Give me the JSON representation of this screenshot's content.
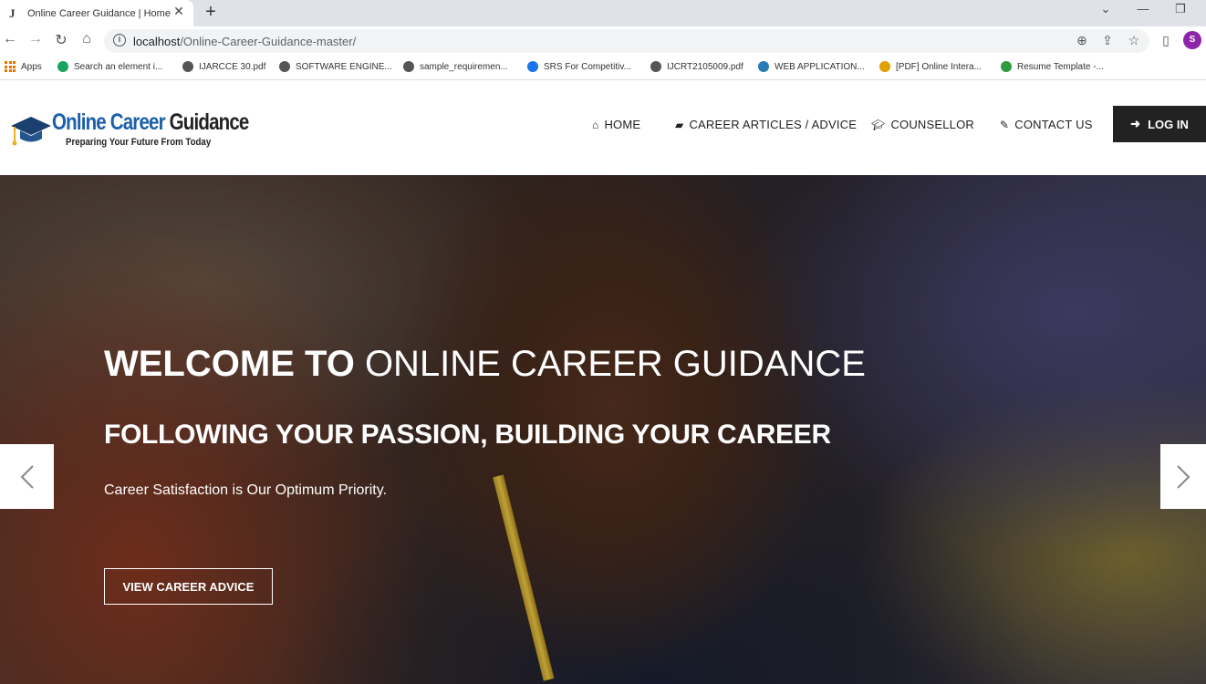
{
  "browser": {
    "tab_favicon": "J",
    "tab_title": "Online Career Guidance | Home",
    "tab_close": "✕",
    "new_tab": "+",
    "url_host": "localhost",
    "url_path": "/Online-Career-Guidance-master/",
    "profile_initial": "S",
    "icons": [
      "back-icon",
      "forward-icon",
      "reload-icon",
      "home-icon",
      "info-icon",
      "zoom-icon",
      "share-icon",
      "star-icon",
      "sidepanel-icon"
    ]
  },
  "bookmarks": [
    {
      "label": "Apps",
      "icon": "apps-grid-icon",
      "color": "#e37400"
    },
    {
      "label": "Search an element i...",
      "icon": "green-circle-icon",
      "color": "#1aa260"
    },
    {
      "label": "IJARCCE 30.pdf",
      "icon": "globe-icon",
      "color": "#555555"
    },
    {
      "label": "SOFTWARE ENGINE...",
      "icon": "globe-icon",
      "color": "#555555"
    },
    {
      "label": "sample_requiremen...",
      "icon": "globe-icon",
      "color": "#555555"
    },
    {
      "label": "SRS For Competitiv...",
      "icon": "s-icon",
      "color": "#1a73e8"
    },
    {
      "label": "IJCRT2105009.pdf",
      "icon": "globe-icon",
      "color": "#555555"
    },
    {
      "label": "WEB APPLICATION...",
      "icon": "web-icon",
      "color": "#2a7ab8"
    },
    {
      "label": "[PDF] Online Intera...",
      "icon": "pdf-icon",
      "color": "#e0a000"
    },
    {
      "label": "Resume Template -...",
      "icon": "resume-icon",
      "color": "#2e9b3e"
    }
  ],
  "site": {
    "logo_part1": "Online Career",
    "logo_part2": "Guidance",
    "logo_tagline": "Preparing Your Future From Today",
    "nav": [
      {
        "label": "HOME",
        "icon": "home-icon"
      },
      {
        "label": "CAREER ARTICLES / ADVICE",
        "icon": "book-icon"
      },
      {
        "label": "COUNSELLOR",
        "icon": "graduation-cap-icon"
      },
      {
        "label": "CONTACT US",
        "icon": "edit-icon"
      }
    ],
    "login_label": "LOG IN",
    "login_icon": "sign-in-icon"
  },
  "hero": {
    "title_strong": "WELCOME TO",
    "title_light": "ONLINE CAREER GUIDANCE",
    "subtitle": "FOLLOWING YOUR PASSION, BUILDING YOUR CAREER",
    "text": "Career Satisfaction is Our Optimum Priority.",
    "cta_label": "VIEW CAREER ADVICE"
  }
}
